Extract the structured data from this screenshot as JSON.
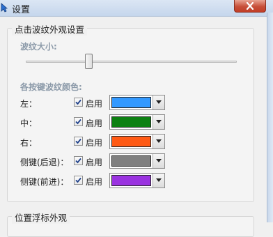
{
  "window": {
    "title": "设置"
  },
  "groups": {
    "click_ripple": {
      "title": "点击波纹外观设置",
      "size_label": "波纹大小:",
      "size_value": 0.29,
      "colors_label": "各按键波纹颜色:",
      "rows": [
        {
          "label": "左：",
          "enabled_label": "启用",
          "checked": true,
          "color": "#3399ff"
        },
        {
          "label": "中：",
          "enabled_label": "启用",
          "checked": true,
          "color": "#0d8012"
        },
        {
          "label": "右：",
          "enabled_label": "启用",
          "checked": true,
          "color": "#ff5a14"
        },
        {
          "label": "侧键(后退)：",
          "enabled_label": "启用",
          "checked": true,
          "color": "#808080"
        },
        {
          "label": "侧键(前进)：",
          "enabled_label": "启用",
          "checked": true,
          "color": "#9a33e0"
        }
      ]
    },
    "float_indicator": {
      "title": "位置浮标外观"
    }
  },
  "icons": {
    "app": "cursor-arrow-icon",
    "close": "close-icon",
    "dropdown": "chevron-down-icon",
    "check": "checkmark-icon"
  }
}
